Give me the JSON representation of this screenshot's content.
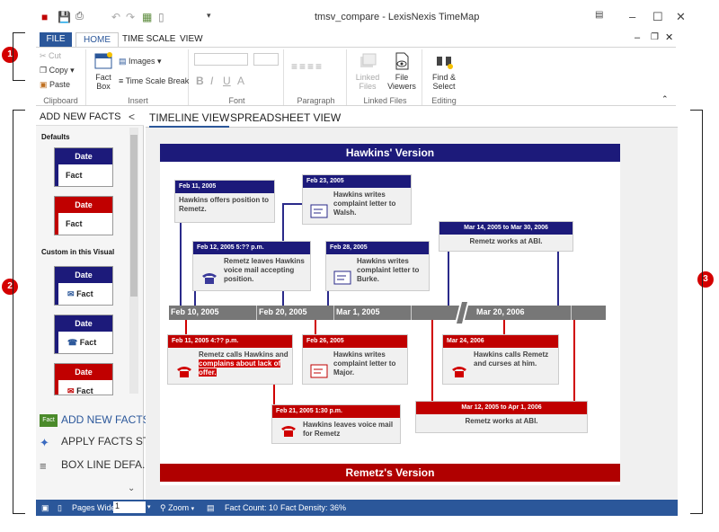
{
  "window": {
    "title": "tmsv_compare - LexisNexis TimeMap"
  },
  "ribbon_tabs": [
    "FILE",
    "HOME",
    "TIME SCALE",
    "VIEW"
  ],
  "ribbon": {
    "clipboard": {
      "cut": "Cut",
      "copy": "Copy",
      "paste": "Paste",
      "label": "Clipboard"
    },
    "insert": {
      "fact_box_line1": "Fact",
      "fact_box_line2": "Box",
      "images": "Images",
      "time_scale_break": "Time Scale Break",
      "label": "Insert"
    },
    "font": {
      "label": "Font"
    },
    "paragraph": {
      "label": "Paragraph"
    },
    "linked_files": {
      "linked_line1": "Linked",
      "linked_line2": "Files",
      "file_viewers_line1": "File",
      "file_viewers_line2": "Viewers",
      "label": "Linked Files"
    },
    "editing": {
      "find_line1": "Find &",
      "find_line2": "Select",
      "label": "Editing"
    }
  },
  "callouts": [
    "1",
    "2",
    "3"
  ],
  "left_pane": {
    "title": "ADD NEW FACTS",
    "collapse": "<",
    "section_defaults": "Defaults",
    "section_custom": "Custom in this Visual",
    "card_date": "Date",
    "card_fact": "Fact",
    "actions": {
      "add_new_facts": "ADD NEW FACTS",
      "apply_facts_style": "APPLY FACTS ST...",
      "box_line_defaults": "BOX LINE DEFA..."
    }
  },
  "view_tabs": {
    "timeline": "TIMELINE VIEW",
    "spreadsheet": "SPREADSHEET VIEW"
  },
  "timeline": {
    "top_banner": "Hawkins' Version",
    "bottom_banner": "Remetz's Version",
    "labels": [
      "Feb 10, 2005",
      "Feb 20, 2005",
      "Mar 1, 2005",
      "Mar 20, 2006"
    ],
    "facts_top": [
      {
        "date": "Feb 11, 2005",
        "text": "Hawkins offers position to Remetz."
      },
      {
        "date": "Feb 23, 2005",
        "text": "Hawkins writes complaint letter to Walsh."
      },
      {
        "date": "Feb 12, 2005 5:?? p.m.",
        "text": "Remetz leaves Hawkins voice mail accepting position."
      },
      {
        "date": "Feb 28, 2005",
        "text": "Hawkins writes complaint letter to Burke."
      },
      {
        "date": "Mar 14, 2005 to Mar 30, 2006",
        "text": "Remetz works at ABI."
      }
    ],
    "facts_bottom": [
      {
        "date": "Feb 11, 2005 4:?? p.m.",
        "text_a": "Remetz calls Hawkins and ",
        "text_b": "complains about lack of offer."
      },
      {
        "date": "Feb 26, 2005",
        "text": "Hawkins writes complaint letter to Major."
      },
      {
        "date": "Mar 24, 2006",
        "text": "Hawkins calls Remetz and curses at him."
      },
      {
        "date": "Mar 12, 2005 to Apr 1, 2006",
        "text": "Remetz works at ABI."
      },
      {
        "date": "Feb 21, 2005 1:30 p.m.",
        "text": "Hawkins leaves voice mail for Remetz"
      }
    ]
  },
  "status": {
    "pages_wide_label": "Pages Wide",
    "pages_wide_value": "1",
    "zoom": "Zoom",
    "fact_count": "Fact Count: 10",
    "fact_density": "Fact Density: 36%"
  },
  "colors": {
    "accent": "#2b579a",
    "hawkins_blue": "#1c1a7a",
    "remetz_red": "#c00000"
  }
}
